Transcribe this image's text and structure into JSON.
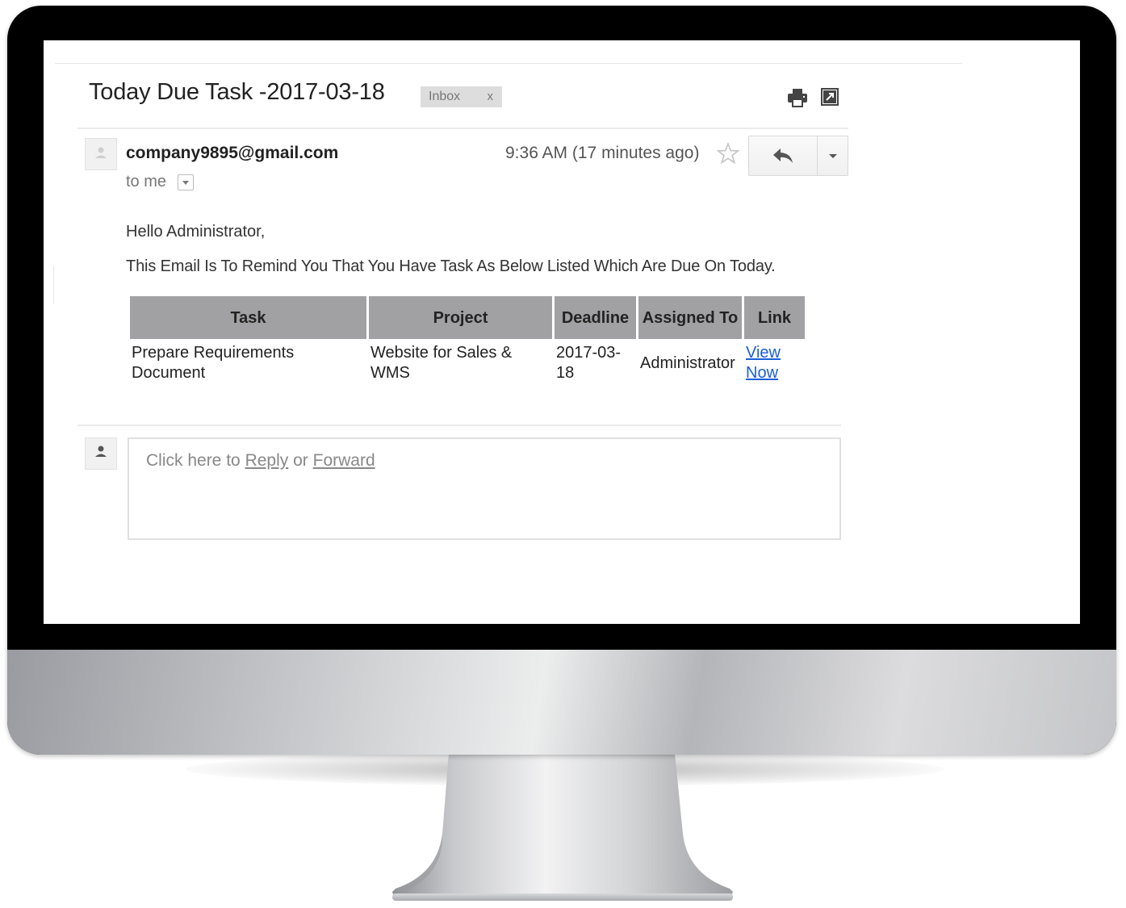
{
  "email": {
    "subject": "Today Due Task -2017-03-18",
    "label": {
      "text": "Inbox",
      "remove": "x"
    },
    "sender": "company9895@gmail.com",
    "recipient": "to me",
    "timestamp": "9:36 AM (17 minutes ago)",
    "greeting": "Hello Administrator,",
    "intro": "This Email Is To Remind You That You Have Task As Below Listed Which Are Due On Today."
  },
  "table": {
    "headers": {
      "task": "Task",
      "project": "Project",
      "deadline": "Deadline",
      "assigned_to": "Assigned To",
      "link": "Link"
    },
    "rows": [
      {
        "task": "Prepare Requirements Document",
        "project": "Website for Sales & WMS",
        "deadline": "2017-03-18",
        "assigned_to": "Administrator",
        "link": "View Now"
      }
    ]
  },
  "reply_box": {
    "prefix": "Click here to",
    "reply": "Reply",
    "or": "or",
    "forward": "Forward"
  },
  "icons": {
    "print": "print-icon",
    "new_window": "new-window-icon",
    "star": "star-icon",
    "reply": "reply-icon",
    "more": "chevron-down-icon",
    "avatar": "person-icon"
  },
  "colors": {
    "table_header": "#a1a1a3",
    "link": "#1a5fd6",
    "label_chip": "#dddddd"
  }
}
